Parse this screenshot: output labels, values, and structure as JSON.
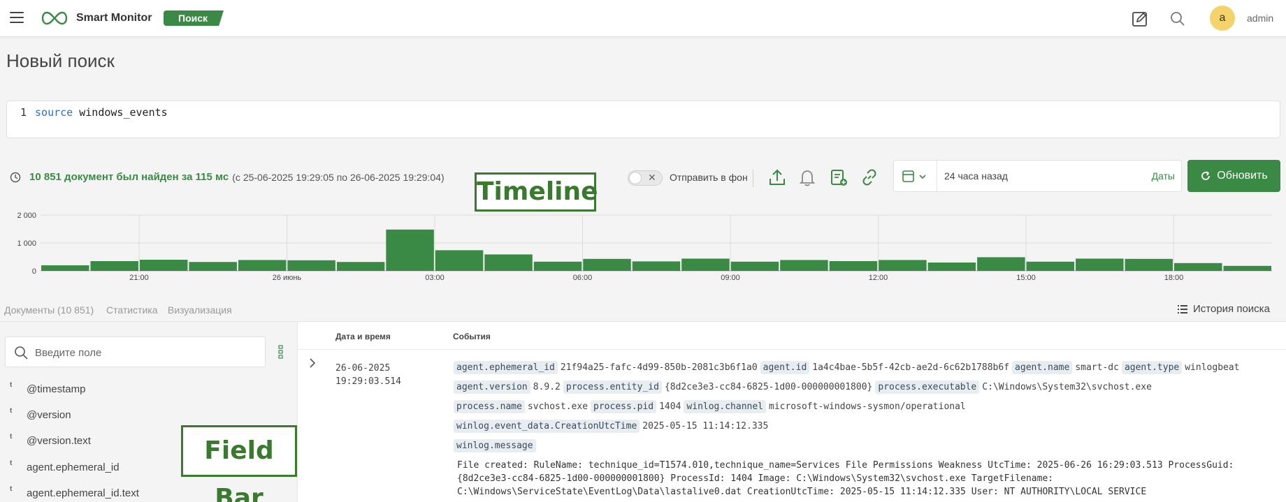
{
  "header": {
    "brand": "Smart Monitor",
    "mode": "Поиск",
    "avatar_letter": "a",
    "username": "admin"
  },
  "page": {
    "title": "Новый поиск"
  },
  "query": {
    "line_number": "1",
    "keyword": "source",
    "index": "windows_events"
  },
  "results": {
    "count_text": "10 851 документ был найден за 115 мс",
    "range_text": "(с 25-06-2025 19:29:05 по 26-06-2025 19:29:04)"
  },
  "annotations": {
    "timeline": "Timeline",
    "field_bar": "Field Bar"
  },
  "controls": {
    "background_label": "Отправить в фон",
    "date_range": "24 часа назад",
    "dates_link": "Даты",
    "refresh_label": "Обновить"
  },
  "chart_data": {
    "type": "bar",
    "ylim": [
      0,
      2000
    ],
    "y_ticks": [
      "2 000",
      "1 000",
      "0"
    ],
    "x_tick_labels": [
      "21:00",
      "26 июнь",
      "03:00",
      "06:00",
      "09:00",
      "12:00",
      "15:00",
      "18:00"
    ],
    "values": [
      200,
      350,
      400,
      320,
      390,
      380,
      320,
      1480,
      740,
      590,
      330,
      430,
      340,
      440,
      330,
      390,
      350,
      390,
      300,
      490,
      330,
      440,
      430,
      280,
      180
    ]
  },
  "tabs": [
    {
      "label": "Документы (10 851)"
    },
    {
      "label": "Статистика"
    },
    {
      "label": "Визуализация"
    }
  ],
  "history_label": "История поиска",
  "fields": {
    "placeholder": "Введите поле",
    "type_label": "t",
    "items": [
      "@timestamp",
      "@version",
      "@version.text",
      "agent.ephemeral_id",
      "agent.ephemeral_id.text"
    ]
  },
  "events": {
    "columns": {
      "date": "Дата и время",
      "events": "События"
    },
    "row": {
      "date": "26-06-2025",
      "time": "19:29:03.514",
      "line1": [
        {
          "key": "agent.ephemeral_id",
          "value": "21f94a25-fafc-4d99-850b-2081c3b6f1a0"
        },
        {
          "key": "agent.id",
          "value": "1a4c4bae-5b5f-42cb-ae2d-6c62b1788b6f"
        },
        {
          "key": "agent.name",
          "value": "smart-dc"
        },
        {
          "key": "agent.type",
          "value": "winlogbeat"
        }
      ],
      "line2": [
        {
          "key": "agent.version",
          "value": "8.9.2"
        },
        {
          "key": "process.entity_id",
          "value": "{8d2ce3e3-cc84-6825-1d00-000000001800}"
        },
        {
          "key": "process.executable",
          "value": "C:\\Windows\\System32\\svchost.exe"
        }
      ],
      "line3": [
        {
          "key": "process.name",
          "value": "svchost.exe"
        },
        {
          "key": "process.pid",
          "value": "1404"
        },
        {
          "key": "winlog.channel",
          "value": "microsoft-windows-sysmon/operational"
        }
      ],
      "line4": [
        {
          "key": "winlog.event_data.CreationUtcTime",
          "value": "2025-05-15 11:14:12.335"
        }
      ],
      "line5": [
        {
          "key": "winlog.message",
          "value": ""
        }
      ],
      "message": "File created: RuleName: technique_id=T1574.010,technique_name=Services File Permissions Weakness UtcTime: 2025-06-26 16:29:03.513 ProcessGuid: {8d2ce3e3-cc84-6825-1d00-000000001800} ProcessId: 1404 Image: C:\\Windows\\System32\\svchost.exe TargetFilename: C:\\Windows\\ServiceState\\EventLog\\Data\\lastalive0.dat CreationUtcTime: 2025-05-15 11:14:12.335 User: NT AUTHORITY\\LOCAL SERVICE"
    }
  }
}
